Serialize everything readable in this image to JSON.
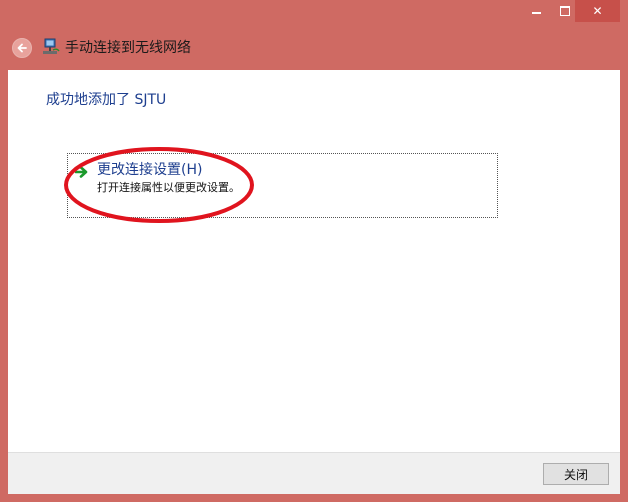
{
  "window": {
    "title": "手动连接到无线网络",
    "accent_color": "#cf6a63",
    "close_glyph": "✕"
  },
  "main": {
    "headline": "成功地添加了 SJTU",
    "link": {
      "title": "更改连接设置(H)",
      "description": "打开连接属性以便更改设置。",
      "icon": "green-arrow-icon"
    }
  },
  "footer": {
    "close_label": "关闭"
  },
  "annotation": {
    "color": "#e0141e",
    "shape": "ellipse"
  }
}
